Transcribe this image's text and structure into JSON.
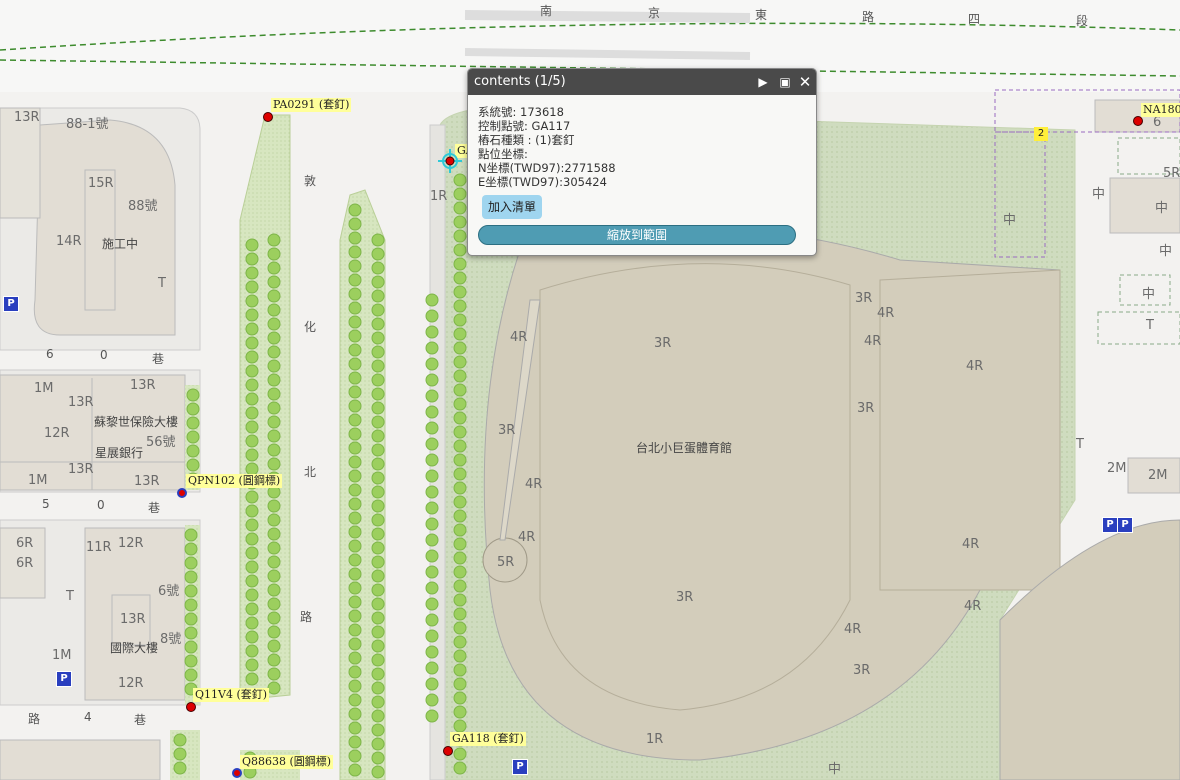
{
  "streets": {
    "top": [
      "南",
      "京",
      "東",
      "路",
      "四",
      "段"
    ],
    "vertical": [
      "敦",
      "化",
      "北",
      "路"
    ],
    "lane60": [
      "6",
      "0",
      "巷"
    ],
    "lane50": [
      "5",
      "0",
      "巷"
    ],
    "lane4": [
      "路",
      "4",
      "巷"
    ]
  },
  "buildings": [
    {
      "t": "13R"
    },
    {
      "t": "88-1號"
    },
    {
      "t": "15R"
    },
    {
      "t": "88號"
    },
    {
      "t": "14R"
    },
    {
      "t": "施工中"
    },
    {
      "t": "T"
    },
    {
      "t": "1M"
    },
    {
      "t": "13R"
    },
    {
      "t": "13R"
    },
    {
      "t": "蘇黎世保險大樓"
    },
    {
      "t": "12R"
    },
    {
      "t": "56號"
    },
    {
      "t": "星展銀行"
    },
    {
      "t": "13R"
    },
    {
      "t": "1M"
    },
    {
      "t": "13R"
    },
    {
      "t": "6R"
    },
    {
      "t": "11R"
    },
    {
      "t": "12R"
    },
    {
      "t": "6R"
    },
    {
      "t": "6號"
    },
    {
      "t": "T"
    },
    {
      "t": "13R"
    },
    {
      "t": "8號"
    },
    {
      "t": "國際大樓"
    },
    {
      "t": "1M"
    },
    {
      "t": "12R"
    },
    {
      "t": "1R"
    },
    {
      "t": "3R"
    },
    {
      "t": "4R"
    },
    {
      "t": "3R"
    },
    {
      "t": "4R"
    },
    {
      "t": "4R"
    },
    {
      "t": "4R"
    },
    {
      "t": "3R"
    },
    {
      "t": "3R"
    },
    {
      "t": "4R"
    },
    {
      "t": "4R"
    },
    {
      "t": "5R"
    },
    {
      "t": "3R"
    },
    {
      "t": "4R"
    },
    {
      "t": "4R"
    },
    {
      "t": "4R"
    },
    {
      "t": "3R"
    },
    {
      "t": "1R"
    },
    {
      "t": "中"
    },
    {
      "t": "6"
    },
    {
      "t": "5R"
    },
    {
      "t": "中"
    },
    {
      "t": "中"
    },
    {
      "t": "中"
    },
    {
      "t": "中"
    },
    {
      "t": "中"
    },
    {
      "t": "T"
    },
    {
      "t": "T"
    },
    {
      "t": "2M"
    },
    {
      "t": "2M"
    }
  ],
  "venue_name": "台北小巨蛋體育館",
  "markers": [
    {
      "label": "PA0291 (套釘)"
    },
    {
      "label": "QPN102 (圓鋼標)"
    },
    {
      "label": "Q11V4 (套釘)"
    },
    {
      "label": "Q88638 (圓鋼標)"
    },
    {
      "label": "GA118 (套釘)"
    },
    {
      "label": "NA180"
    },
    {
      "label": "GA"
    }
  ],
  "cluster_count": "2",
  "parking_label": "P",
  "popup": {
    "title": "contents (1/5)",
    "lines": [
      "系統號: 173618",
      "控制點號: GA117",
      "樁石種類 : (1)套釘",
      "點位坐標:",
      "N坐標(TWD97):2771588",
      "E坐標(TWD97):305424"
    ],
    "add_button": "加入清單",
    "zoom_button": "縮放到範圍",
    "next_icon": "play-icon",
    "maximize_icon": "maximize-icon",
    "close_icon": "close-icon"
  },
  "colors": {
    "park_green": "#d9e9c2",
    "tree_green": "#9ccf5e",
    "building": "#e2ddd4",
    "stadium": "#d3cdbb",
    "dashed_road": "#3d8b2d",
    "marker_red": "#dd0000",
    "label_yellow": "#ffff9a"
  }
}
